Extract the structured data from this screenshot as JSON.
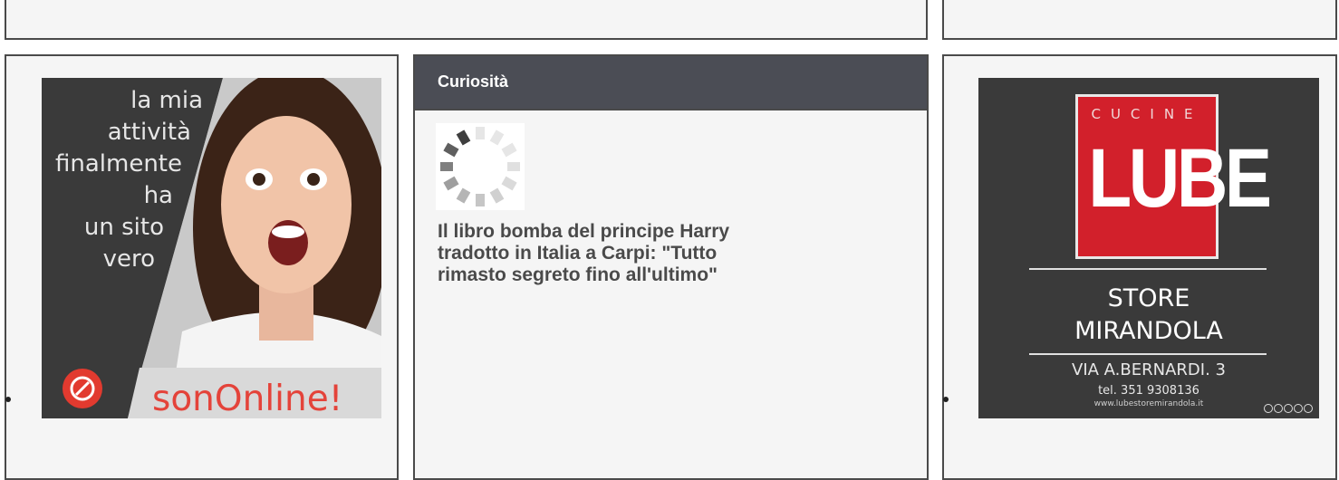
{
  "left_ad": {
    "lines": [
      "la mia",
      "attività",
      "finalmente",
      "ha",
      "un sito",
      "vero"
    ],
    "brand": "sonOnline!",
    "icon": "compass-icon"
  },
  "curiosita": {
    "header": "Curiosità",
    "article_title": "Il libro bomba del principe Harry tradotto in Italia a Carpi: \"Tutto rimasto segreto fino all'ultimo\"",
    "spinner_icon": "loading-spinner-icon"
  },
  "right_ad": {
    "top_word": "CUCINE",
    "brand": "LUBE",
    "store_line1": "STORE",
    "store_line2": "MIRANDOLA",
    "address": "VIA A.BERNARDI. 3",
    "phone": "tel. 351 9308136",
    "website": "www.lubestoremirandola.it",
    "social_icons": [
      "social-icon-1",
      "social-icon-2",
      "social-icon-3",
      "social-icon-4",
      "social-icon-5"
    ]
  },
  "colors": {
    "header_bg": "#4b4d55",
    "lube_red": "#d2202b",
    "sononline_red": "#e4433a"
  }
}
